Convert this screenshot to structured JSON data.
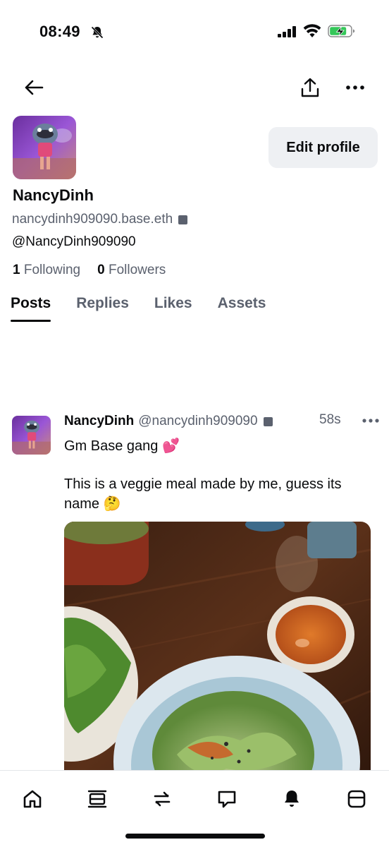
{
  "status_bar": {
    "time": "08:49",
    "icons": [
      "bell-slash-icon",
      "cellular-signal-icon",
      "wifi-icon",
      "battery-charging-icon"
    ]
  },
  "header": {
    "icons": [
      "back-arrow-icon",
      "share-icon",
      "more-horizontal-icon"
    ]
  },
  "profile": {
    "display_name": "NancyDinh",
    "basename": "nancydinh909090.base.eth",
    "handle": "@NancyDinh909090",
    "following_count": "1",
    "following_label": "Following",
    "followers_count": "0",
    "followers_label": "Followers",
    "edit_button": "Edit profile"
  },
  "tabs": [
    {
      "label": "Posts",
      "active": true
    },
    {
      "label": "Replies",
      "active": false
    },
    {
      "label": "Likes",
      "active": false
    },
    {
      "label": "Assets",
      "active": false
    }
  ],
  "post": {
    "author": "NancyDinh",
    "handle": "@nancydinh909090",
    "time": "58s",
    "line1": "Gm Base gang 💕",
    "line2": "This is a veggie meal made by me, guess its name 🤔",
    "image_alt": "photo of a veggie salad bowl, herbs and dipping sauce on a wooden table"
  },
  "bottom_nav": {
    "items": [
      "home-icon",
      "feed-icon",
      "swap-icon",
      "messages-icon",
      "notifications-icon",
      "wallet-icon"
    ]
  },
  "colors": {
    "text_primary": "#0a0b0d",
    "text_secondary": "#5b616e",
    "button_bg": "#eef0f3",
    "battery_charge": "#34c759"
  }
}
